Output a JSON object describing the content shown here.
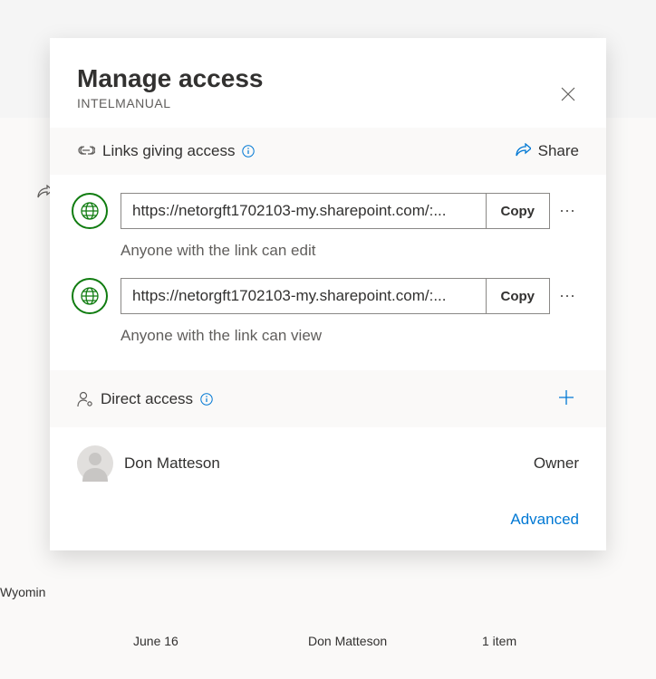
{
  "modal": {
    "title": "Manage access",
    "subtitle": "INTELMANUAL"
  },
  "links_section": {
    "title": "Links giving access",
    "share_label": "Share",
    "items": [
      {
        "url": "https://netorgft1702103-my.sharepoint.com/:...",
        "copy_label": "Copy",
        "description": "Anyone with the link can edit"
      },
      {
        "url": "https://netorgft1702103-my.sharepoint.com/:...",
        "copy_label": "Copy",
        "description": "Anyone with the link can view"
      }
    ]
  },
  "direct_section": {
    "title": "Direct access"
  },
  "people": [
    {
      "name": "Don Matteson",
      "role": "Owner"
    }
  ],
  "footer": {
    "advanced": "Advanced"
  },
  "background": {
    "wyomin": "Wyomin",
    "june": "June 16",
    "don": "Don Matteson",
    "item": "1 item"
  }
}
